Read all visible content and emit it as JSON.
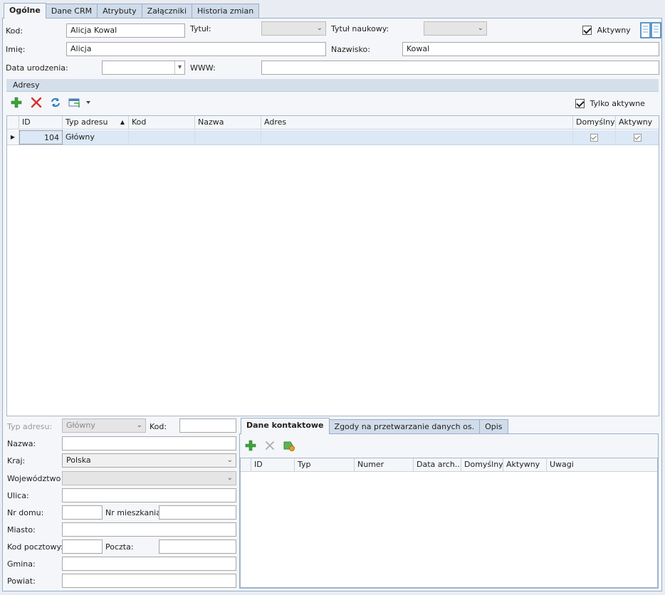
{
  "tabs": [
    "Ogólne",
    "Dane CRM",
    "Atrybuty",
    "Załączniki",
    "Historia zmian"
  ],
  "form": {
    "kod_label": "Kod:",
    "kod_value": "Alicja Kowal",
    "tytul_label": "Tytuł:",
    "tytul_value": "",
    "tytul_naukowy_label": "Tytuł naukowy:",
    "tytul_naukowy_value": "",
    "aktywny_label": "Aktywny",
    "imie_label": "Imię:",
    "imie_value": "Alicja",
    "nazwisko_label": "Nazwisko:",
    "nazwisko_value": "Kowal",
    "data_label": "Data urodzenia:",
    "data_value": "",
    "www_label": "WWW:",
    "www_value": ""
  },
  "addresses": {
    "section_title": "Adresy",
    "only_active_label": "Tylko aktywne",
    "columns": [
      "ID",
      "Typ adresu",
      "Kod",
      "Nazwa",
      "Adres",
      "Domyślny",
      "Aktywny"
    ],
    "rows": [
      {
        "id": "104",
        "typ": "Główny",
        "kod": "",
        "nazwa": "",
        "adres": "",
        "domyslny": true,
        "aktywny": true
      }
    ]
  },
  "address_form": {
    "typ_label": "Typ adresu:",
    "typ_value": "Główny",
    "kod_label": "Kod:",
    "kod_value": "",
    "nazwa_label": "Nazwa:",
    "nazwa_value": "",
    "kraj_label": "Kraj:",
    "kraj_value": "Polska",
    "woj_label": "Województwo",
    "woj_value": "",
    "ulica_label": "Ulica:",
    "ulica_value": "",
    "nrdomu_label": "Nr domu:",
    "nrdomu_value": "",
    "nrmiesz_label": "Nr mieszkania:",
    "nrmiesz_value": "",
    "miasto_label": "Miasto:",
    "miasto_value": "",
    "kodpoczt_label": "Kod pocztowy:",
    "kodpoczt_value": "",
    "poczta_label": "Poczta:",
    "poczta_value": "",
    "gmina_label": "Gmina:",
    "gmina_value": "",
    "powiat_label": "Powiat:",
    "powiat_value": ""
  },
  "contact": {
    "tabs": [
      "Dane kontaktowe",
      "Zgody na przetwarzanie danych os.",
      "Opis"
    ],
    "columns": [
      "ID",
      "Typ",
      "Numer",
      "Data arch...",
      "Domyślny",
      "Aktywny",
      "Uwagi"
    ]
  },
  "colors": {
    "accent_green": "#3aa33a",
    "delete_red": "#d9302c",
    "refresh_blue": "#2a7ab8",
    "selected_row": "#dce8f5"
  }
}
